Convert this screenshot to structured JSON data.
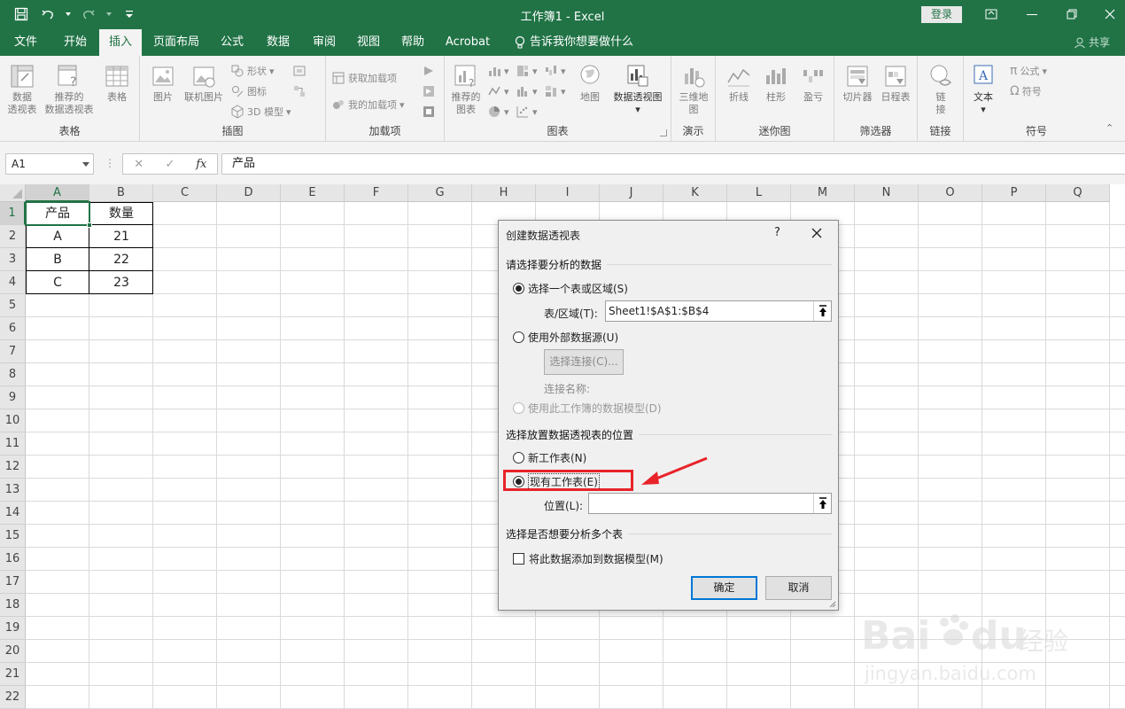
{
  "window": {
    "title": "工作簿1  -  Excel",
    "login_label": "登录",
    "share_label": "共享",
    "tell_me": "告诉我你想要做什么"
  },
  "tabs": [
    "文件",
    "开始",
    "插入",
    "页面布局",
    "公式",
    "数据",
    "审阅",
    "视图",
    "帮助",
    "Acrobat"
  ],
  "active_tab": "插入",
  "ribbon": {
    "groups": {
      "tables": "表格",
      "illustrations": "插图",
      "addins": "加载项",
      "charts": "图表",
      "tours": "演示",
      "sparklines": "迷你图",
      "filters": "筛选器",
      "links": "链接",
      "symbols": "符号"
    },
    "buttons": {
      "pivot_line1": "数据",
      "pivot_line2": "透视表",
      "rec_pivot_line1": "推荐的",
      "rec_pivot_line2": "数据透视表",
      "table": "表格",
      "picture": "图片",
      "online_picture": "联机图片",
      "shapes": "形状",
      "icons": "图标",
      "model3d": "3D 模型",
      "get_addins": "获取加载项",
      "my_addins": "我的加载项",
      "rec_charts_line1": "推荐的",
      "rec_charts_line2": "图表",
      "maps": "地图",
      "pivot_chart": "数据透视图",
      "map3d_line1": "三维地",
      "map3d_line2": "图",
      "line": "折线",
      "column": "柱形",
      "winloss": "盈亏",
      "slicer": "切片器",
      "timeline": "日程表",
      "link_line1": "链",
      "link_line2": "接",
      "text": "文本",
      "equation": "公式",
      "symbol": "符号"
    }
  },
  "formula_bar": {
    "name_box": "A1",
    "fx": "fx",
    "value": "产品"
  },
  "grid": {
    "columns": [
      "A",
      "B",
      "C",
      "D",
      "E",
      "F",
      "G",
      "H",
      "I",
      "J",
      "K",
      "L",
      "M",
      "N",
      "O",
      "P",
      "Q"
    ],
    "rows": [
      "1",
      "2",
      "3",
      "4",
      "5",
      "6",
      "7",
      "8",
      "9",
      "10",
      "11",
      "12",
      "13",
      "14",
      "15",
      "16",
      "17",
      "18",
      "19",
      "20",
      "21",
      "22"
    ],
    "data": [
      [
        "产品",
        "数量"
      ],
      [
        "A",
        "21"
      ],
      [
        "B",
        "22"
      ],
      [
        "C",
        "23"
      ]
    ]
  },
  "dialog": {
    "title": "创建数据透视表",
    "help": "?",
    "section1": "请选择要分析的数据",
    "opt_table_range": "选择一个表或区域(S)",
    "table_range_label": "表/区域(T):",
    "table_range_value": "Sheet1!$A$1:$B$4",
    "opt_external": "使用外部数据源(U)",
    "choose_connection": "选择连接(C)...",
    "connection_name": "连接名称:",
    "opt_data_model": "使用此工作簿的数据模型(D)",
    "section2": "选择放置数据透视表的位置",
    "opt_new_sheet": "新工作表(N)",
    "opt_existing_sheet": "现有工作表(E)",
    "location_label": "位置(L):",
    "location_value": "",
    "section3": "选择是否想要分析多个表",
    "add_to_model": "将此数据添加到数据模型(M)",
    "ok": "确定",
    "cancel": "取消"
  },
  "watermark": {
    "brand": "Bai",
    "brand2": "du",
    "cn": "经验",
    "url": "jingyan.baidu.com"
  }
}
